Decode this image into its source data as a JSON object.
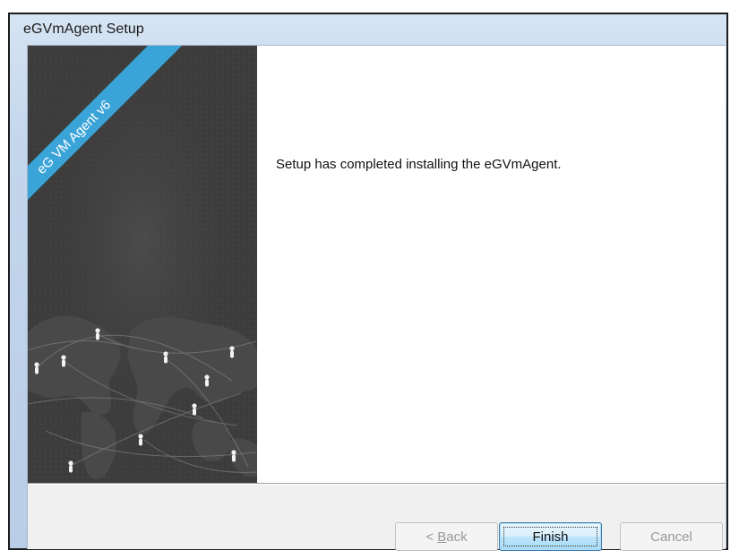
{
  "window": {
    "title": "eGVmAgent Setup"
  },
  "banner": {
    "ribbon_text": "eG VM Agent v6",
    "ribbon_color": "#3aa4d8",
    "background_color": "#3b3b3b"
  },
  "content": {
    "message": "Setup has completed installing the eGVmAgent."
  },
  "buttons": {
    "back": {
      "prefix": "< ",
      "accel": "B",
      "rest": "ack",
      "enabled": false
    },
    "finish": {
      "label": "Finish",
      "enabled": true,
      "default": true
    },
    "cancel": {
      "label": "Cancel",
      "enabled": false
    }
  }
}
